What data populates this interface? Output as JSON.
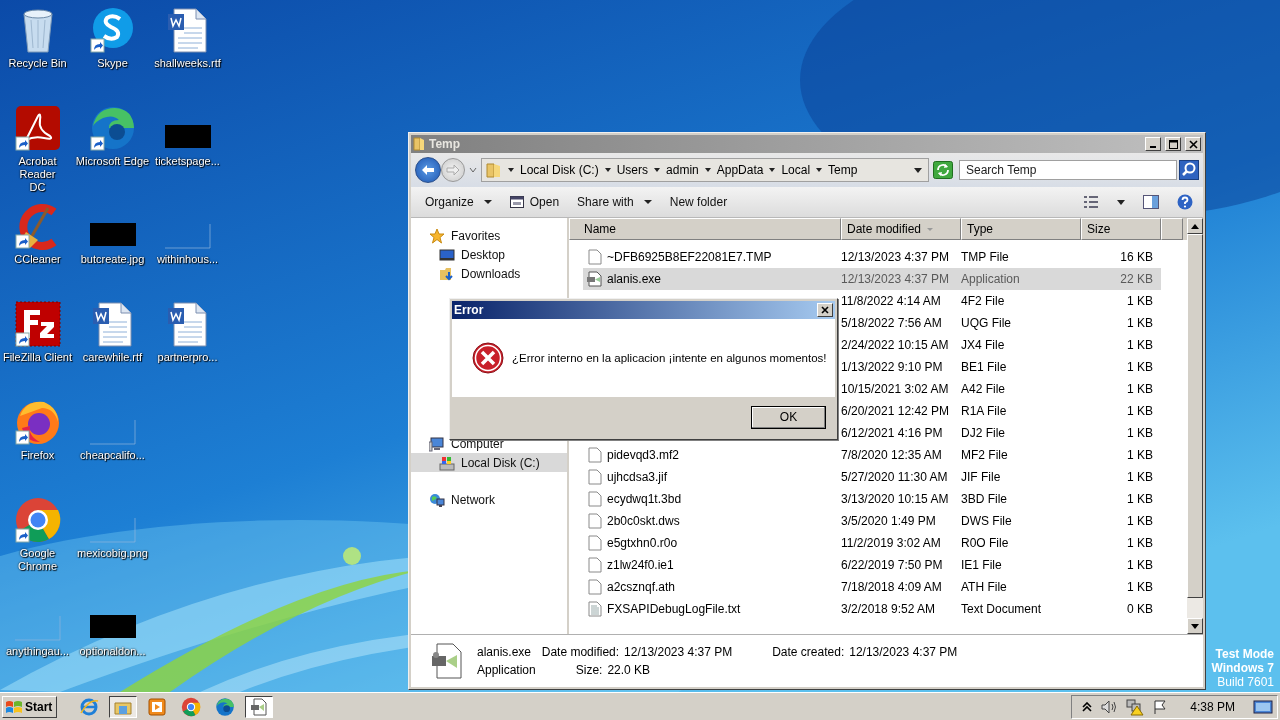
{
  "desktop": {
    "icons": [
      {
        "label": "Recycle Bin",
        "kind": "recycle",
        "shortcut": false
      },
      {
        "label": "Acrobat Reader DC",
        "kind": "acrobat",
        "shortcut": true
      },
      {
        "label": "CCleaner",
        "kind": "ccleaner",
        "shortcut": true
      },
      {
        "label": "FileZilla Client",
        "kind": "filezilla",
        "shortcut": true
      },
      {
        "label": "Firefox",
        "kind": "firefox",
        "shortcut": true
      },
      {
        "label": "Google Chrome",
        "kind": "chrome",
        "shortcut": true
      },
      {
        "label": "anythingau...",
        "kind": "blank",
        "shortcut": false
      },
      {
        "label": "Skype",
        "kind": "skype",
        "shortcut": true
      },
      {
        "label": "Microsoft Edge",
        "kind": "edge",
        "shortcut": true
      },
      {
        "label": "butcreate.jpg",
        "kind": "redacted",
        "shortcut": false
      },
      {
        "label": "carewhile.rtf",
        "kind": "word",
        "shortcut": false
      },
      {
        "label": "cheapcalifo...",
        "kind": "blank",
        "shortcut": false
      },
      {
        "label": "mexicobig.png",
        "kind": "blank",
        "shortcut": false
      },
      {
        "label": "optionaldon...",
        "kind": "redacted",
        "shortcut": false
      },
      {
        "label": "shallweeks.rtf",
        "kind": "word",
        "shortcut": false
      },
      {
        "label": "ticketspage...",
        "kind": "redacted",
        "shortcut": false
      },
      {
        "label": "withinhous...",
        "kind": "blank",
        "shortcut": false
      },
      {
        "label": "partnerpro...",
        "kind": "word",
        "shortcut": false
      }
    ]
  },
  "explorer": {
    "title": "Temp",
    "breadcrumb": [
      "Local Disk (C:)",
      "Users",
      "admin",
      "AppData",
      "Local",
      "Temp"
    ],
    "search": {
      "placeholder": "Search Temp"
    },
    "toolbar": [
      {
        "label": "Organize",
        "kind": "menu"
      },
      {
        "label": "Open",
        "kind": "open"
      },
      {
        "label": "Share with",
        "kind": "menu"
      },
      {
        "label": "New folder",
        "kind": "plain"
      }
    ],
    "nav": [
      {
        "label": "Favorites",
        "kind": "star",
        "selected": false,
        "children": [
          {
            "label": "Desktop",
            "kind": "desktop",
            "selected": false
          },
          {
            "label": "Downloads",
            "kind": "downloads",
            "selected": false
          }
        ]
      },
      {
        "label": "Computer",
        "kind": "computer",
        "selected": false,
        "children": [
          {
            "label": "Local Disk (C:)",
            "kind": "disk",
            "selected": true
          }
        ]
      },
      {
        "label": "Network",
        "kind": "network",
        "selected": false
      }
    ],
    "columns": [
      {
        "label": "Name",
        "sorted": false
      },
      {
        "label": "Date modified",
        "sorted": true
      },
      {
        "label": "Type",
        "sorted": false
      },
      {
        "label": "Size",
        "sorted": false
      }
    ],
    "files": [
      {
        "name": "~DFB6925B8EF22081E7.TMP",
        "date": "12/13/2023 4:37 PM",
        "type": "TMP File",
        "size": "16 KB",
        "kind": "file",
        "selected": false
      },
      {
        "name": "alanis.exe",
        "date": "12/13/2023 4:37 PM",
        "type": "Application",
        "size": "22 KB",
        "kind": "exe",
        "selected": true
      },
      {
        "date": "11/8/2022 4:14 AM",
        "type": "4F2 File",
        "size": "1 KB",
        "selected": false
      },
      {
        "date": "5/18/2022 7:56 AM",
        "type": "UQG File",
        "size": "1 KB",
        "selected": false
      },
      {
        "date": "2/24/2022 10:15 AM",
        "type": "JX4 File",
        "size": "1 KB",
        "selected": false
      },
      {
        "date": "1/13/2022 9:10 PM",
        "type": "BE1 File",
        "size": "1 KB",
        "selected": false
      },
      {
        "date": "10/15/2021 3:02 AM",
        "type": "A42 File",
        "size": "1 KB",
        "selected": false
      },
      {
        "date": "6/20/2021 12:42 PM",
        "type": "R1A File",
        "size": "1 KB",
        "selected": false
      },
      {
        "date": "6/12/2021 4:16 PM",
        "type": "DJ2 File",
        "size": "1 KB",
        "selected": false
      },
      {
        "name": "pidevqd3.mf2",
        "date": "7/8/2020 12:35 AM",
        "type": "MF2 File",
        "size": "1 KB",
        "kind": "file",
        "selected": false
      },
      {
        "name": "ujhcdsa3.jif",
        "date": "5/27/2020 11:30 AM",
        "type": "JIF File",
        "size": "1 KB",
        "kind": "file",
        "selected": false
      },
      {
        "name": "ecydwq1t.3bd",
        "date": "3/13/2020 10:15 AM",
        "type": "3BD File",
        "size": "1 KB",
        "kind": "file",
        "selected": false
      },
      {
        "name": "2b0c0skt.dws",
        "date": "3/5/2020 1:49 PM",
        "type": "DWS File",
        "size": "1 KB",
        "kind": "file",
        "selected": false
      },
      {
        "name": "e5gtxhn0.r0o",
        "date": "11/2/2019 3:02 AM",
        "type": "R0O File",
        "size": "1 KB",
        "kind": "file",
        "selected": false
      },
      {
        "name": "z1lw24f0.ie1",
        "date": "6/22/2019 7:50 PM",
        "type": "IE1 File",
        "size": "1 KB",
        "kind": "file",
        "selected": false
      },
      {
        "name": "a2csznqf.ath",
        "date": "7/18/2018 4:09 AM",
        "type": "ATH File",
        "size": "1 KB",
        "kind": "file",
        "selected": false
      },
      {
        "name": "FXSAPIDebugLogFile.txt",
        "date": "3/2/2018 9:52 AM",
        "type": "Text Document",
        "size": "0 KB",
        "kind": "text",
        "selected": false
      }
    ],
    "details": {
      "name": "alanis.exe",
      "type": "Application",
      "fields": [
        {
          "label": "Date modified:",
          "value": "12/13/2023 4:37 PM"
        },
        {
          "label": "Date created:",
          "value": "12/13/2023 4:37 PM"
        },
        {
          "label": "Size:",
          "value": "22.0 KB"
        }
      ]
    }
  },
  "dialog": {
    "title": "Error",
    "message": "¿Error interno en la aplicacion ¡intente en algunos momentos!",
    "button": "OK"
  },
  "os_notice": [
    "Test Mode",
    "Windows 7",
    "Build 7601"
  ],
  "taskbar": {
    "start": "Start",
    "apps": [
      {
        "kind": "ie",
        "active": false
      },
      {
        "kind": "explorer",
        "active": true
      },
      {
        "kind": "media",
        "active": false
      },
      {
        "kind": "chrome",
        "active": false
      },
      {
        "kind": "edge",
        "active": false
      },
      {
        "kind": "exe",
        "active": true
      }
    ],
    "tray": [
      {
        "kind": "chevron"
      },
      {
        "kind": "speaker"
      },
      {
        "kind": "network"
      },
      {
        "kind": "flag"
      }
    ],
    "clock": "4:38 PM"
  }
}
